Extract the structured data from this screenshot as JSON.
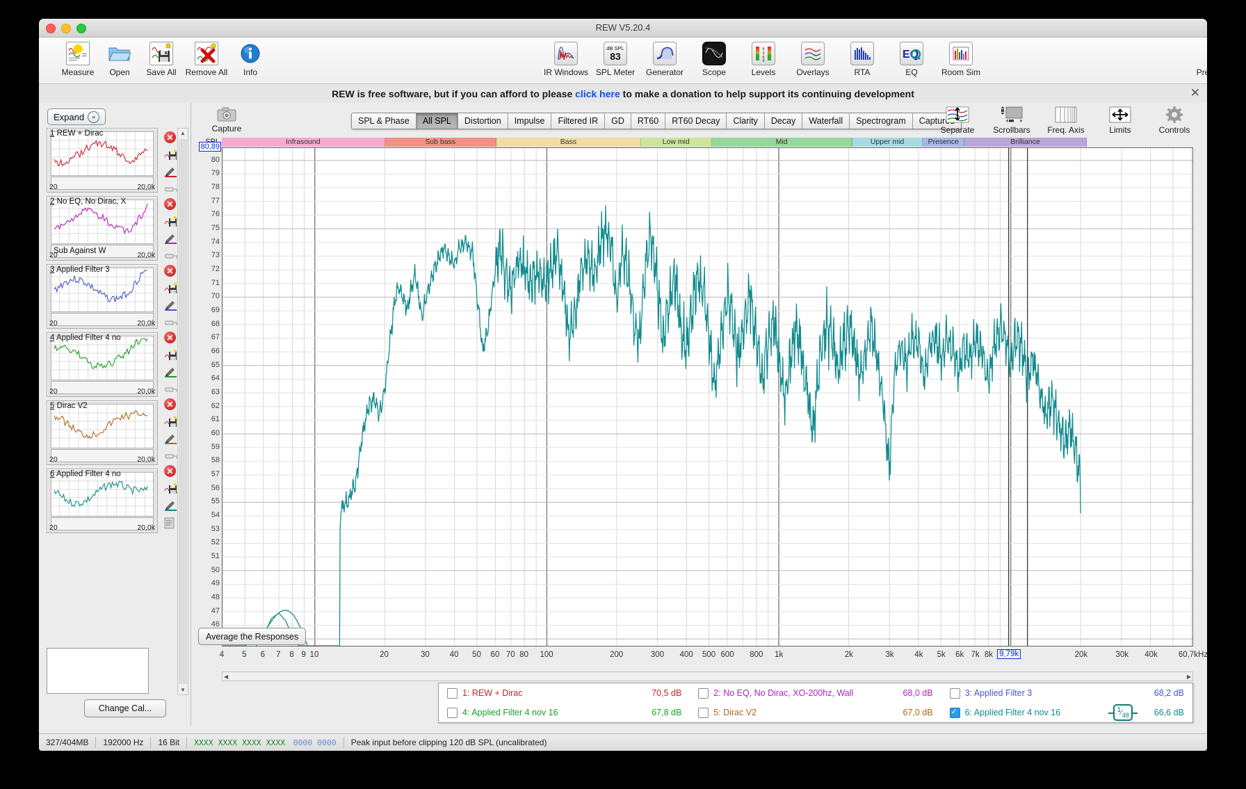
{
  "window": {
    "title": "REW V5.20.4"
  },
  "toolbar": {
    "left": [
      {
        "label": "Measure",
        "icon": "measure-icon"
      },
      {
        "label": "Open",
        "icon": "folder-open-icon"
      },
      {
        "label": "Save All",
        "icon": "save-icon"
      },
      {
        "label": "Remove All",
        "icon": "remove-all-icon"
      },
      {
        "label": "Info",
        "icon": "info-icon"
      }
    ],
    "center": [
      {
        "label": "IR Windows",
        "icon": "ir-windows-icon"
      },
      {
        "label": "SPL Meter",
        "icon": "spl-meter-icon",
        "value": "83",
        "unit": "dB SPL"
      },
      {
        "label": "Generator",
        "icon": "generator-icon"
      },
      {
        "label": "Scope",
        "icon": "scope-icon"
      },
      {
        "label": "Levels",
        "icon": "levels-icon"
      },
      {
        "label": "Overlays",
        "icon": "overlays-icon"
      },
      {
        "label": "RTA",
        "icon": "rta-icon"
      },
      {
        "label": "EQ",
        "icon": "eq-icon"
      },
      {
        "label": "Room Sim",
        "icon": "room-sim-icon"
      }
    ],
    "right": [
      {
        "label": "Preferences",
        "icon": "wrench-icon"
      }
    ]
  },
  "banner": {
    "pre": "REW is free software, but if you can afford to please ",
    "link": "click here",
    "post": " to make a donation to help support its continuing development",
    "close": "✕"
  },
  "sidebar": {
    "expand_label": "Expand",
    "expand_icon": "chevron-double-right-icon",
    "change_cal_label": "Change Cal...",
    "measurements": [
      {
        "num": "1",
        "name": "REW + Dirac",
        "color": "#cc2027",
        "min": "20",
        "max": "20,0k",
        "footer": ""
      },
      {
        "num": "2",
        "name": "No EQ, No Dirac, X",
        "color": "#b520c0",
        "min": "20",
        "max": "20,0k",
        "footer": "Sub Against W"
      },
      {
        "num": "3",
        "name": "Applied Filter 3",
        "color": "#4456c8",
        "min": "20",
        "max": "20,0k",
        "footer": ""
      },
      {
        "num": "4",
        "name": "Applied Filter 4 no",
        "color": "#19a020",
        "min": "20",
        "max": "20,0k",
        "footer": ""
      },
      {
        "num": "5",
        "name": "Dirac V2",
        "color": "#b2651a",
        "min": "20",
        "max": "20,0k",
        "footer": ""
      },
      {
        "num": "6",
        "name": "Applied Filter 4 no",
        "color": "#0f8a8d",
        "min": "20",
        "max": "20,0k",
        "footer": ""
      }
    ]
  },
  "graph_toolbar": {
    "capture_label": "Capture",
    "capture_icon": "camera-icon",
    "tabs": [
      {
        "label": "SPL & Phase",
        "active": false
      },
      {
        "label": "All SPL",
        "active": true
      },
      {
        "label": "Distortion",
        "active": false
      },
      {
        "label": "Impulse",
        "active": false
      },
      {
        "label": "Filtered IR",
        "active": false
      },
      {
        "label": "GD",
        "active": false
      },
      {
        "label": "RT60",
        "active": false
      },
      {
        "label": "RT60 Decay",
        "active": false
      },
      {
        "label": "Clarity",
        "active": false
      },
      {
        "label": "Decay",
        "active": false
      },
      {
        "label": "Waterfall",
        "active": false
      },
      {
        "label": "Spectrogram",
        "active": false
      },
      {
        "label": "Captured",
        "active": false
      }
    ],
    "right_tools": [
      {
        "label": "Separate",
        "icon": "separate-icon"
      },
      {
        "label": "Scrollbars",
        "icon": "scrollbars-icon"
      },
      {
        "label": "Freq. Axis",
        "icon": "freq-axis-icon"
      },
      {
        "label": "Limits",
        "icon": "limits-icon"
      },
      {
        "label": "Controls",
        "icon": "gear-icon"
      }
    ]
  },
  "chart_data": {
    "type": "line",
    "title": "All SPL",
    "xlabel": "",
    "ylabel": "SPL",
    "y_axis_label": "SPL",
    "y_cursor_value": "80,89",
    "x_cursor_value": "9,79k",
    "xlim": [
      4,
      60700
    ],
    "ylim": [
      44.5,
      80.9
    ],
    "x_scale": "log",
    "grid": true,
    "legend_position": "bottom",
    "yticks": [
      80,
      79,
      78,
      77,
      76,
      75,
      74,
      73,
      72,
      71,
      70,
      69,
      68,
      67,
      66,
      65,
      64,
      63,
      62,
      61,
      60,
      59,
      58,
      57,
      56,
      55,
      54,
      53,
      52,
      51,
      50,
      49,
      48,
      47,
      46,
      45
    ],
    "xticks": [
      {
        "v": 4,
        "label": "4"
      },
      {
        "v": 5,
        "label": "5"
      },
      {
        "v": 6,
        "label": "6"
      },
      {
        "v": 7,
        "label": "7"
      },
      {
        "v": 8,
        "label": "8"
      },
      {
        "v": 9,
        "label": "9"
      },
      {
        "v": 10,
        "label": "10"
      },
      {
        "v": 20,
        "label": "20"
      },
      {
        "v": 30,
        "label": "30"
      },
      {
        "v": 40,
        "label": "40"
      },
      {
        "v": 50,
        "label": "50"
      },
      {
        "v": 60,
        "label": "60"
      },
      {
        "v": 70,
        "label": "70"
      },
      {
        "v": 80,
        "label": "80"
      },
      {
        "v": 100,
        "label": "100"
      },
      {
        "v": 200,
        "label": "200"
      },
      {
        "v": 300,
        "label": "300"
      },
      {
        "v": 400,
        "label": "400"
      },
      {
        "v": 500,
        "label": "500"
      },
      {
        "v": 600,
        "label": "600"
      },
      {
        "v": 800,
        "label": "800"
      },
      {
        "v": 1000,
        "label": "1k"
      },
      {
        "v": 2000,
        "label": "2k"
      },
      {
        "v": 3000,
        "label": "3k"
      },
      {
        "v": 4000,
        "label": "4k"
      },
      {
        "v": 5000,
        "label": "5k"
      },
      {
        "v": 6000,
        "label": "6k"
      },
      {
        "v": 7000,
        "label": "7k"
      },
      {
        "v": 8000,
        "label": "8k"
      },
      {
        "v": 20000,
        "label": "20k"
      },
      {
        "v": 30000,
        "label": "30k"
      },
      {
        "v": 40000,
        "label": "40k"
      },
      {
        "v": 60700,
        "label": "60,7kHz"
      }
    ],
    "bands": [
      {
        "label": "Infrasound",
        "from": 4,
        "to": 20,
        "color": "#f7a9ce"
      },
      {
        "label": "Sub bass",
        "from": 20,
        "to": 60,
        "color": "#f39186"
      },
      {
        "label": "Bass",
        "from": 60,
        "to": 250,
        "color": "#f2dca0"
      },
      {
        "label": "Low mid",
        "from": 250,
        "to": 500,
        "color": "#cde59a"
      },
      {
        "label": "Mid",
        "from": 500,
        "to": 2000,
        "color": "#96d79b"
      },
      {
        "label": "Upper mid",
        "from": 2000,
        "to": 4000,
        "color": "#a6dbe4"
      },
      {
        "label": "Presence",
        "from": 4000,
        "to": 6000,
        "color": "#a8b6e5"
      },
      {
        "label": "Brilliance",
        "from": 6000,
        "to": 20000,
        "color": "#b9a6d8"
      }
    ],
    "series": [
      {
        "name": "6: Applied Filter 4 nov 16",
        "color": "#0f8a8d",
        "visible": true,
        "x": [
          4,
          5,
          6,
          6.5,
          7,
          7.5,
          8,
          8.5,
          9,
          10,
          11,
          12,
          13,
          14,
          15,
          16,
          17,
          18,
          19,
          20,
          21,
          22,
          23,
          24,
          25,
          26,
          27,
          28,
          29,
          30,
          32,
          34,
          36,
          38,
          40,
          42,
          45,
          48,
          50,
          53,
          56,
          60,
          63,
          67,
          70,
          75,
          80,
          85,
          90,
          95,
          100,
          106,
          112,
          118,
          125,
          132,
          140,
          150,
          160,
          170,
          180,
          190,
          200,
          212,
          224,
          236,
          250,
          265,
          280,
          300,
          315,
          335,
          355,
          375,
          400,
          425,
          450,
          475,
          500,
          530,
          560,
          600,
          630,
          670,
          710,
          750,
          800,
          850,
          900,
          950,
          1000,
          1060,
          1120,
          1180,
          1250,
          1320,
          1400,
          1500,
          1600,
          1700,
          1800,
          1900,
          2000,
          2120,
          2240,
          2360,
          2500,
          2650,
          2800,
          3000,
          3150,
          3350,
          3550,
          3750,
          4000,
          4250,
          4500,
          4750,
          5000,
          5300,
          5600,
          6000,
          6300,
          6700,
          7100,
          7500,
          8000,
          8500,
          9000,
          9500,
          10000,
          10600,
          11200,
          11800,
          12500,
          13200,
          14000,
          15000,
          16000,
          17000,
          18000,
          19000,
          20000
        ],
        "y": [
          44.5,
          44.5,
          45.2,
          46.5,
          46.9,
          46.3,
          45.2,
          44.5,
          44.5,
          44.5,
          44.5,
          44.5,
          54.5,
          55.1,
          56.5,
          59.8,
          62.0,
          62.5,
          61.5,
          63.0,
          66.5,
          69.5,
          70.8,
          70.0,
          69.2,
          70.5,
          71.8,
          70.2,
          68.5,
          69.8,
          71.5,
          72.8,
          73.5,
          73.0,
          72.4,
          73.6,
          74.0,
          73.2,
          70.2,
          66.0,
          68.0,
          72.0,
          73.5,
          71.5,
          70.5,
          72.5,
          72.0,
          70.8,
          71.6,
          71.4,
          71.0,
          72.4,
          73.2,
          70.5,
          66.8,
          68.5,
          72.0,
          73.0,
          71.5,
          74.0,
          75.0,
          73.5,
          70.0,
          73.5,
          72.0,
          68.5,
          66.5,
          72.0,
          74.5,
          71.0,
          67.0,
          69.5,
          71.5,
          68.0,
          66.0,
          69.5,
          71.5,
          70.5,
          67.0,
          63.5,
          66.5,
          70.2,
          68.5,
          65.5,
          68.0,
          70.5,
          67.0,
          64.0,
          66.5,
          68.5,
          65.5,
          62.5,
          65.0,
          68.0,
          66.0,
          63.5,
          60.0,
          65.5,
          68.0,
          67.0,
          64.5,
          66.5,
          68.2,
          66.5,
          64.0,
          66.0,
          68.0,
          65.5,
          62.5,
          57.5,
          64.5,
          66.5,
          65.0,
          67.0,
          66.5,
          64.0,
          66.5,
          67.0,
          65.5,
          67.0,
          66.0,
          64.5,
          66.5,
          65.5,
          67.0,
          66.0,
          64.0,
          66.5,
          68.0,
          67.0,
          65.0,
          67.5,
          66.0,
          64.0,
          65.5,
          63.5,
          61.5,
          62.5,
          61.0,
          59.5,
          60.5,
          58.5,
          57.0,
          56.0,
          54.5
        ]
      }
    ],
    "series_hidden": [
      {
        "name": "1: REW + Dirac",
        "color": "#cc2027",
        "visible": false
      },
      {
        "name": "2: No EQ, No Dirac, XO-200hz, Wall",
        "color": "#b520c0",
        "visible": false
      },
      {
        "name": "3: Applied Filter 3",
        "color": "#4456c8",
        "visible": false
      },
      {
        "name": "4: Applied Filter 4 nov 16",
        "color": "#19a020",
        "visible": false
      },
      {
        "name": "5: Dirac V2",
        "color": "#b2651a",
        "visible": false
      }
    ],
    "cursor_lines_x": [
      9790,
      11800
    ]
  },
  "avg_button": {
    "label": "Average the Responses"
  },
  "legend": {
    "rows": [
      [
        {
          "id": "1",
          "label": "1: REW + Dirac",
          "value": "70,5 dB",
          "color": "#cc2027",
          "checked": false
        },
        {
          "id": "2",
          "label": "2: No EQ, No Dirac, XO-200hz, Wall",
          "value": "68,0 dB",
          "color": "#b520c0",
          "checked": false
        },
        {
          "id": "3",
          "label": "3: Applied Filter 3",
          "value": "68,2 dB",
          "color": "#4456c8",
          "checked": false
        }
      ],
      [
        {
          "id": "4",
          "label": "4: Applied Filter 4 nov 16",
          "value": "67,8 dB",
          "color": "#19a020",
          "checked": false
        },
        {
          "id": "5",
          "label": "5: Dirac V2",
          "value": "67,0 dB",
          "color": "#b2651a",
          "checked": false
        },
        {
          "id": "6",
          "label": "6: Applied Filter 4 nov 16",
          "value": "66,6 dB",
          "color": "#0f8a8d",
          "checked": true
        }
      ]
    ],
    "smoothing": "1/48"
  },
  "statusbar": {
    "memory": "327/404MB",
    "samplerate": "192000 Hz",
    "bitdepth": "16 Bit",
    "meter_x": "XXXX XXXX  XXXX XXXX",
    "meter_0": "0000 0000",
    "message": "Peak input before clipping 120 dB SPL (uncalibrated)"
  }
}
